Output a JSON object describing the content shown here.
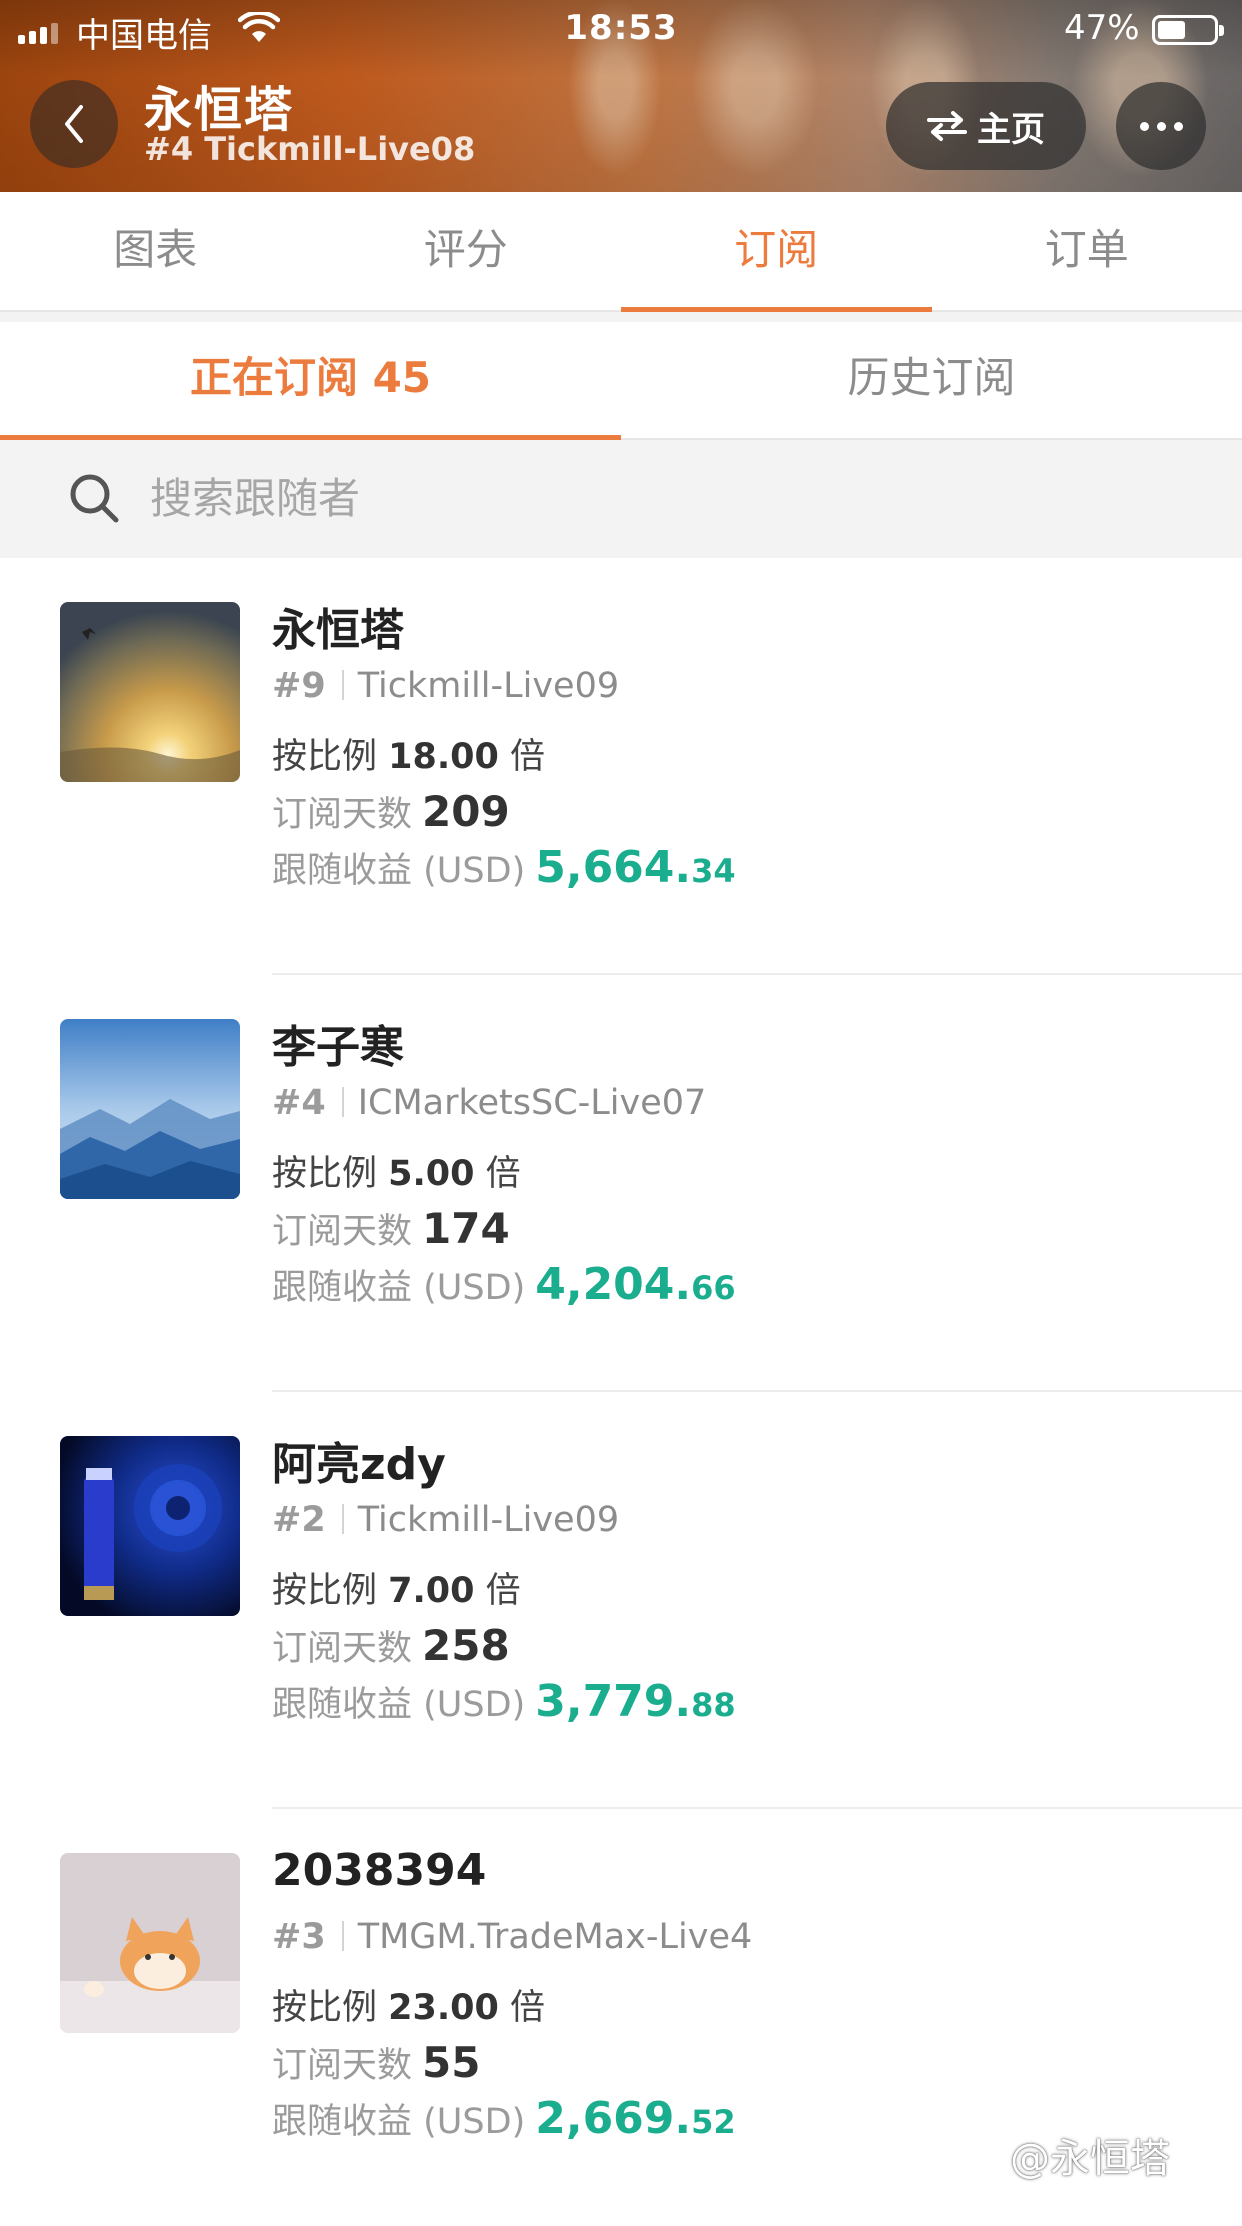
{
  "status_bar": {
    "carrier": "中国电信",
    "time": "18:53",
    "battery": "47%"
  },
  "header": {
    "title": "永恒塔",
    "subtitle": "#4 Tickmill-Live08",
    "home_label": "主页"
  },
  "main_tabs": [
    {
      "label": "图表"
    },
    {
      "label": "评分"
    },
    {
      "label": "订阅"
    },
    {
      "label": "订单"
    }
  ],
  "sub_tabs": [
    {
      "label": "正在订阅 45"
    },
    {
      "label": "历史订阅"
    }
  ],
  "search": {
    "placeholder": "搜索跟随者"
  },
  "labels": {
    "ratio_prefix": "按比例",
    "ratio_suffix": "倍",
    "days": "订阅天数",
    "profit": "跟随收益 (USD)"
  },
  "followers": [
    {
      "name": "永恒塔",
      "rank": "#9",
      "server": "Tickmill-Live09",
      "ratio": "18.00",
      "days": "209",
      "profit_int": "5,664.",
      "profit_dec": "34"
    },
    {
      "name": "李子寒",
      "rank": "#4",
      "server": "ICMarketsSC-Live07",
      "ratio": "5.00",
      "days": "174",
      "profit_int": "4,204.",
      "profit_dec": "66"
    },
    {
      "name": "阿亮zdy",
      "rank": "#2",
      "server": "Tickmill-Live09",
      "ratio": "7.00",
      "days": "258",
      "profit_int": "3,779.",
      "profit_dec": "88"
    },
    {
      "name": "2038394",
      "rank": "#3",
      "server": "TMGM.TradeMax-Live4",
      "ratio": "23.00",
      "days": "55",
      "profit_int": "2,669.",
      "profit_dec": "52"
    }
  ],
  "watermark": "@永恒塔",
  "colors": {
    "accent": "#ec7b3e",
    "profit": "#1aad8e",
    "muted": "#8c8c8c"
  }
}
